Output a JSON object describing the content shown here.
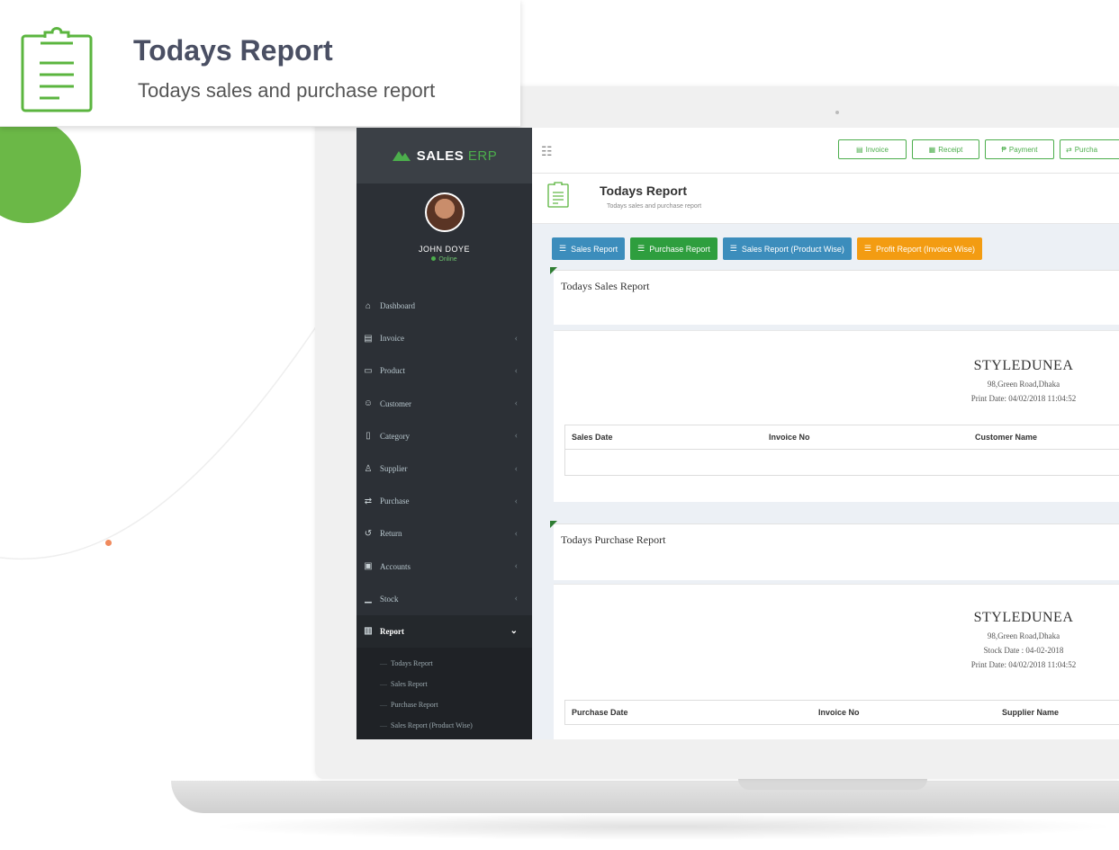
{
  "promo": {
    "title": "Todays Report",
    "subtitle": "Todays sales and purchase report"
  },
  "app": {
    "logo": {
      "name": "SALES",
      "suffix": "ERP"
    },
    "user": {
      "name": "JOHN DOYE",
      "status": "Online"
    },
    "menu": [
      {
        "label": "Dashboard",
        "icon": "dashboard-icon",
        "glyph": "⌂",
        "has_children": false
      },
      {
        "label": "Invoice",
        "icon": "invoice-icon",
        "glyph": "▤",
        "has_children": true
      },
      {
        "label": "Product",
        "icon": "product-icon",
        "glyph": "▭",
        "has_children": true
      },
      {
        "label": "Customer",
        "icon": "customer-icon",
        "glyph": "☺",
        "has_children": true
      },
      {
        "label": "Category",
        "icon": "category-icon",
        "glyph": "▯",
        "has_children": true
      },
      {
        "label": "Supplier",
        "icon": "supplier-icon",
        "glyph": "♙",
        "has_children": true
      },
      {
        "label": "Purchase",
        "icon": "purchase-icon",
        "glyph": "⇄",
        "has_children": true
      },
      {
        "label": "Return",
        "icon": "return-icon",
        "glyph": "↺",
        "has_children": true
      },
      {
        "label": "Accounts",
        "icon": "accounts-icon",
        "glyph": "▣",
        "has_children": true
      },
      {
        "label": "Stock",
        "icon": "stock-icon",
        "glyph": "▁",
        "has_children": true
      },
      {
        "label": "Report",
        "icon": "report-icon",
        "glyph": "▥",
        "has_children": true,
        "active": true
      }
    ],
    "report_submenu": [
      "Todays Report",
      "Sales Report",
      "Purchase Report",
      "Sales Report (Product Wise)"
    ],
    "quick_buttons": [
      "Invoice",
      "Receipt",
      "Payment",
      "Purcha"
    ],
    "page": {
      "title": "Todays Report",
      "subtitle": "Todays sales and purchase report"
    },
    "tabs": [
      {
        "label": "Sales Report",
        "color": "#3c8dbc"
      },
      {
        "label": "Purchase Report",
        "color": "#2e9e3e"
      },
      {
        "label": "Sales Report (Product Wise)",
        "color": "#3c8dbc"
      },
      {
        "label": "Profit Report (Invoice Wise)",
        "color": "#f39c12"
      }
    ],
    "sales_section": {
      "title": "Todays Sales Report",
      "company": "STYLEDUNEA",
      "address": "98,Green Road,Dhaka",
      "print_date": "Print Date: 04/02/2018 11:04:52",
      "columns": [
        "Sales Date",
        "Invoice No",
        "Customer Name"
      ]
    },
    "purchase_section": {
      "title": "Todays Purchase Report",
      "company": "STYLEDUNEA",
      "address": "98,Green Road,Dhaka",
      "stock_date": "Stock Date : 04-02-2018",
      "print_date": "Print Date: 04/02/2018 11:04:52",
      "columns": [
        "Purchase Date",
        "Invoice No",
        "Supplier Name"
      ]
    }
  },
  "colors": {
    "accent_green": "#4cae4c",
    "sidebar_bg": "#2c3036",
    "promo_circle": "#6bb847"
  }
}
